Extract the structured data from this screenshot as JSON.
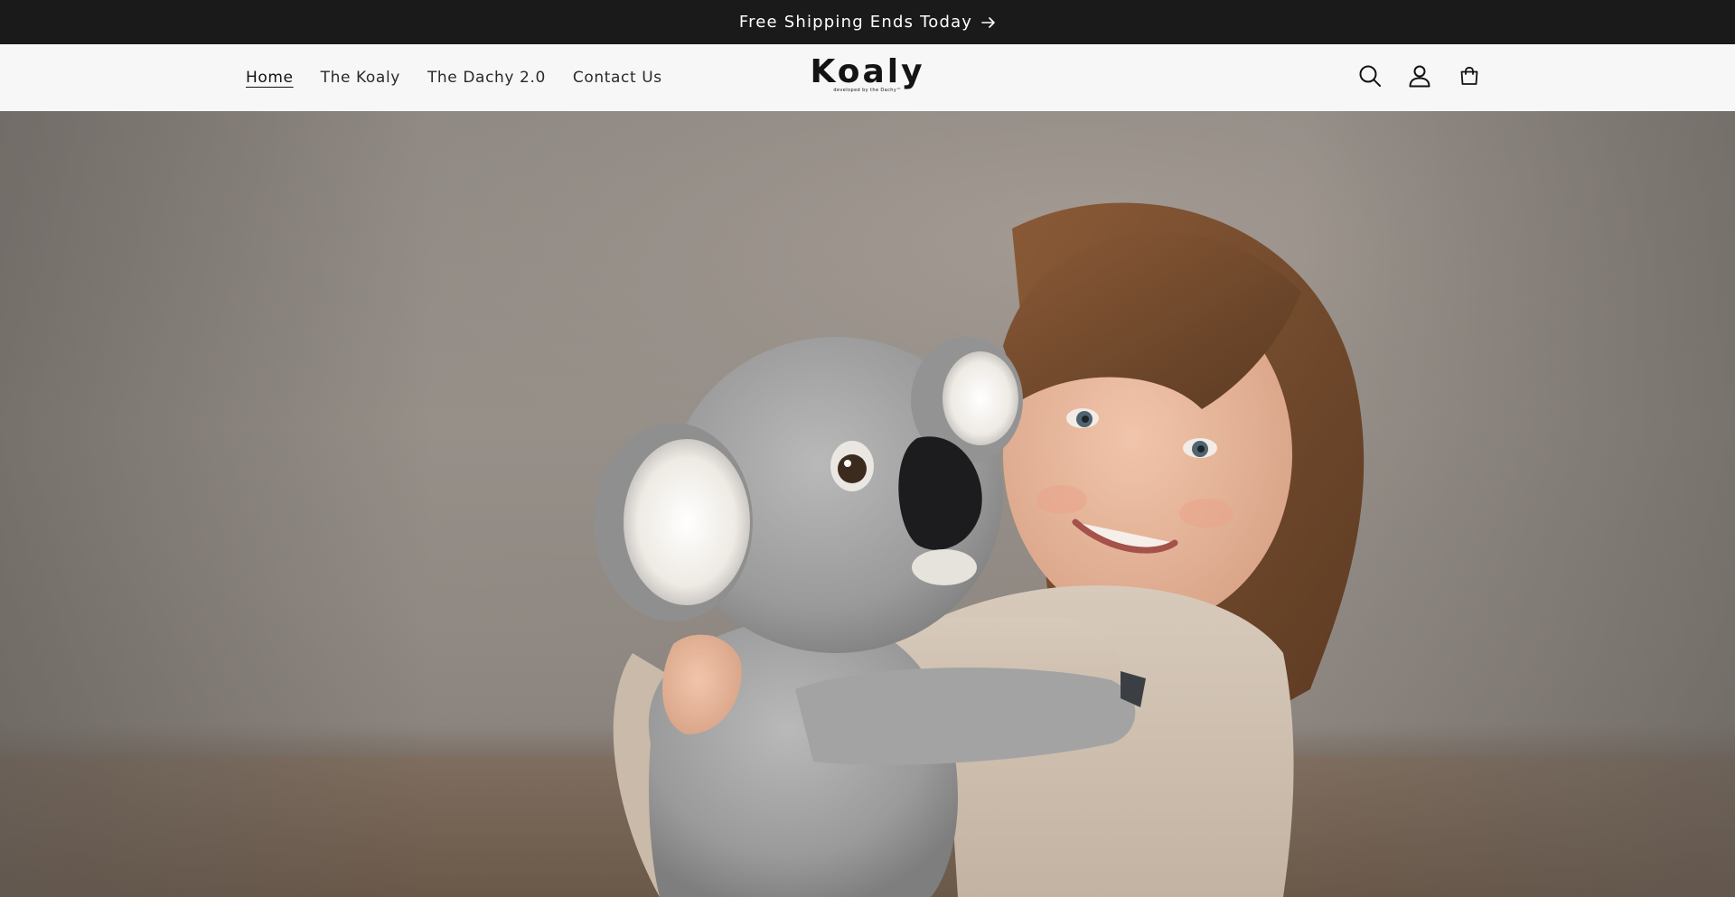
{
  "announcement": {
    "text": "Free Shipping Ends Today",
    "arrow_icon": "arrow-right-icon"
  },
  "nav": {
    "items": [
      {
        "label": "Home",
        "active": true
      },
      {
        "label": "The Koaly",
        "active": false
      },
      {
        "label": "The Dachy 2.0",
        "active": false
      },
      {
        "label": "Contact Us",
        "active": false
      }
    ]
  },
  "logo": {
    "wordmark": "Koaly",
    "tagline": "developed by the Dachy™"
  },
  "header_icons": {
    "search": "search-icon",
    "account": "account-icon",
    "cart": "cart-icon"
  },
  "hero": {
    "image_subject": "girl-hugging-koala-plush"
  },
  "colors": {
    "announcement_bg": "#1a1a1a",
    "header_bg": "#f7f7f7",
    "text": "#121212"
  }
}
